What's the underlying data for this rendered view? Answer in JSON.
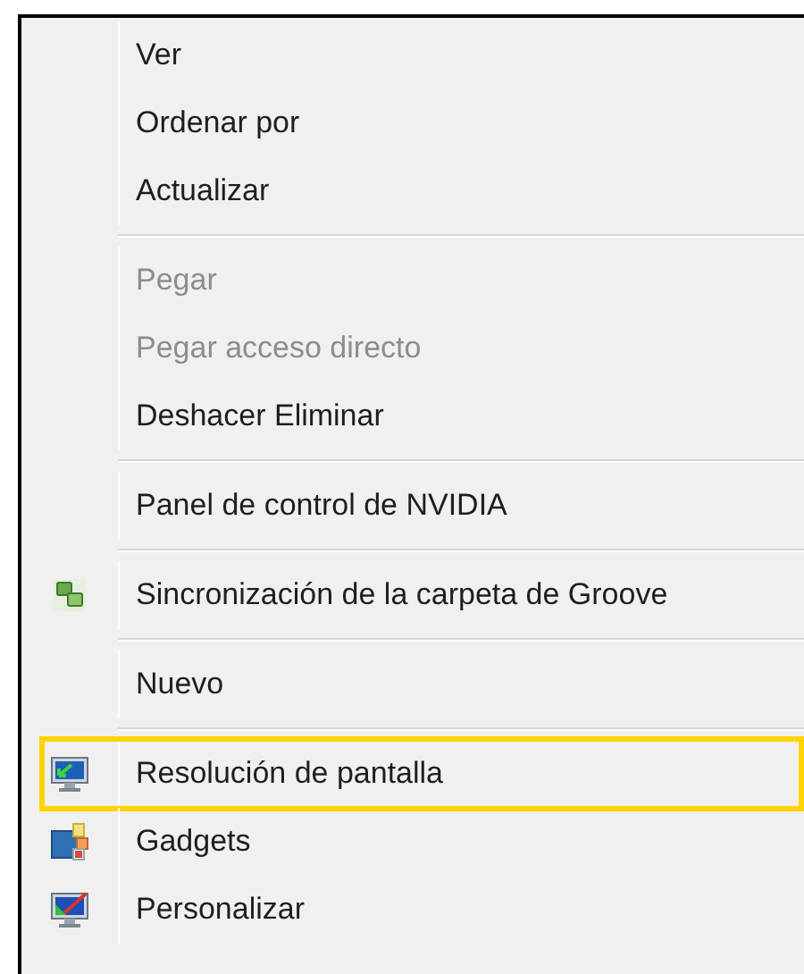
{
  "menu": {
    "groups": [
      [
        {
          "label": "Ver",
          "disabled": false,
          "selected": false
        },
        {
          "label": "Ordenar por",
          "disabled": false,
          "selected": false
        },
        {
          "label": "Actualizar",
          "disabled": false,
          "selected": false
        }
      ],
      [
        {
          "label": "Pegar",
          "disabled": true,
          "selected": false
        },
        {
          "label": "Pegar acceso directo",
          "disabled": true,
          "selected": false
        },
        {
          "label": "Deshacer Eliminar",
          "disabled": false,
          "selected": false
        }
      ],
      [
        {
          "label": "Panel de control de NVIDIA",
          "disabled": false,
          "selected": false
        }
      ],
      [
        {
          "label": "Sincronización de la carpeta de Groove",
          "disabled": false,
          "selected": false,
          "kind": "sync"
        }
      ],
      [
        {
          "label": "Nuevo",
          "disabled": false,
          "selected": false
        }
      ],
      [
        {
          "label": "Resolución de pantalla",
          "disabled": false,
          "selected": true,
          "kind": "display"
        },
        {
          "label": "Gadgets",
          "disabled": false,
          "selected": false,
          "kind": "gadgets"
        },
        {
          "label": "Personalizar",
          "disabled": false,
          "selected": false,
          "kind": "personalize"
        }
      ]
    ]
  }
}
